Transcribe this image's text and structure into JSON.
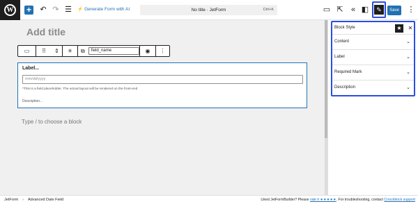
{
  "toolbar": {
    "add_label": "+",
    "generate_label": "Generate Form with AI",
    "doc_title": "No title · JetForm",
    "shortcut": "Ctrl+K",
    "save_label": "Save",
    "accent": "#2271b1",
    "highlight": "#2a4de0"
  },
  "canvas": {
    "page_title": "Add title",
    "block_toolbar": {
      "field_name": "field_name"
    },
    "block": {
      "label": "Label...",
      "placeholder": "mm/dd/yyyy",
      "note": "*This is a field placeholder. The actual layout will be rendered on the front-end",
      "description": "Description..."
    },
    "appender": "Type / to choose a block"
  },
  "sidebar": {
    "title": "Block Style",
    "sections": [
      "Content",
      "Label",
      "Required Mark",
      "Description"
    ]
  },
  "footer": {
    "crumbs": [
      "JetForm",
      "Advanced Date Field"
    ],
    "liked": "Liked JetFormBuilder? Please",
    "rate_link": "rate it ★★★★★",
    "troubleshoot": ". For troubleshooting, contact",
    "support_link": "Crocoblock support"
  }
}
